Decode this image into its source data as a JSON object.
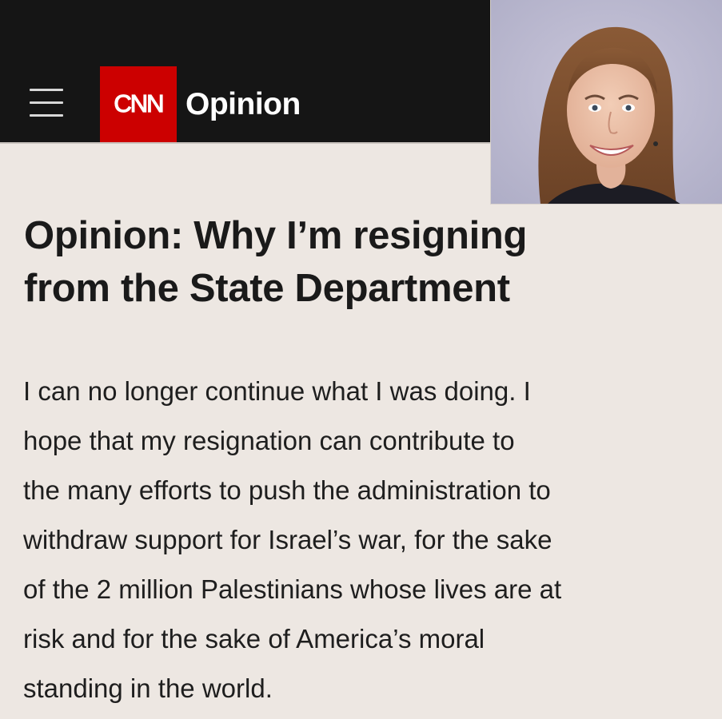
{
  "header": {
    "logo_text": "CNN",
    "section_label": "Opinion",
    "colors": {
      "bar": "#151515",
      "logo": "#cc0000"
    },
    "menu_icon": "hamburger-menu-icon"
  },
  "article": {
    "headline_lines": [
      "Opinion: Why I’m resigning",
      "from the State Department"
    ],
    "body_lines": [
      "I can no longer continue what I was doing. I",
      "hope that my resignation can contribute to",
      "the many efforts to push the administration to",
      "withdraw support for Israel’s war, for the sake",
      "of the 2 million Palestinians whose lives are at",
      "risk and for the sake of America’s moral",
      "standing in the world."
    ]
  }
}
